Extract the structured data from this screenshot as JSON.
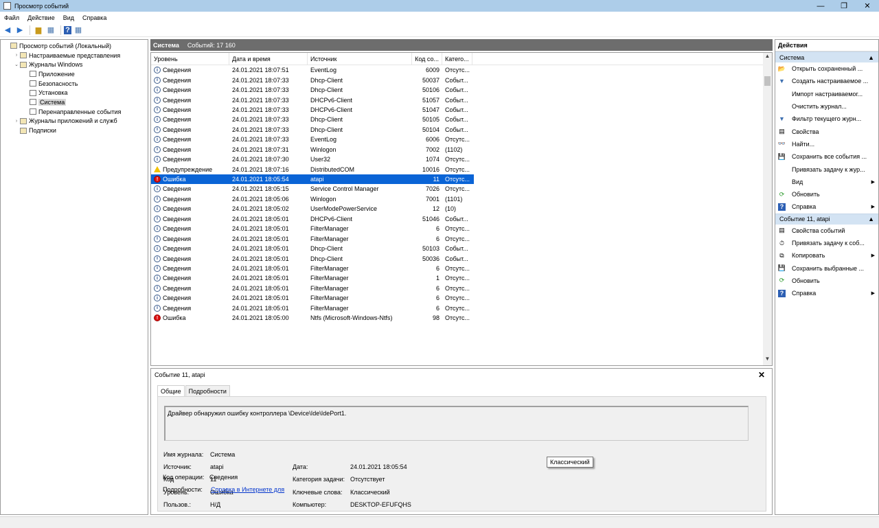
{
  "window": {
    "title": "Просмотр событий",
    "min": "—",
    "max": "❐",
    "close": "✕"
  },
  "menu": [
    "Файл",
    "Действие",
    "Вид",
    "Справка"
  ],
  "tree": [
    {
      "label": "Просмотр событий (Локальный)",
      "level": 0,
      "arrow": ""
    },
    {
      "label": "Настраиваемые представления",
      "level": 1,
      "arrow": "›"
    },
    {
      "label": "Журналы Windows",
      "level": 1,
      "arrow": "⌄"
    },
    {
      "label": "Приложение",
      "level": 2,
      "arrow": ""
    },
    {
      "label": "Безопасность",
      "level": 2,
      "arrow": ""
    },
    {
      "label": "Установка",
      "level": 2,
      "arrow": ""
    },
    {
      "label": "Система",
      "level": 2,
      "arrow": "",
      "selected": true
    },
    {
      "label": "Перенаправленные события",
      "level": 2,
      "arrow": ""
    },
    {
      "label": "Журналы приложений и служб",
      "level": 1,
      "arrow": "›"
    },
    {
      "label": "Подписки",
      "level": 1,
      "arrow": ""
    }
  ],
  "list": {
    "title": "Система",
    "count": "Событий: 17 160",
    "columns": [
      "Уровень",
      "Дата и время",
      "Источник",
      "Код со...",
      "Катего..."
    ],
    "rows": [
      {
        "level": "Сведения",
        "type": "info",
        "date": "24.01.2021 18:07:51",
        "source": "EventLog",
        "code": "6009",
        "cat": "Отсутс..."
      },
      {
        "level": "Сведения",
        "type": "info",
        "date": "24.01.2021 18:07:33",
        "source": "Dhcp-Client",
        "code": "50037",
        "cat": "Событ..."
      },
      {
        "level": "Сведения",
        "type": "info",
        "date": "24.01.2021 18:07:33",
        "source": "Dhcp-Client",
        "code": "50106",
        "cat": "Событ..."
      },
      {
        "level": "Сведения",
        "type": "info",
        "date": "24.01.2021 18:07:33",
        "source": "DHCPv6-Client",
        "code": "51057",
        "cat": "Событ..."
      },
      {
        "level": "Сведения",
        "type": "info",
        "date": "24.01.2021 18:07:33",
        "source": "DHCPv6-Client",
        "code": "51047",
        "cat": "Событ..."
      },
      {
        "level": "Сведения",
        "type": "info",
        "date": "24.01.2021 18:07:33",
        "source": "Dhcp-Client",
        "code": "50105",
        "cat": "Событ..."
      },
      {
        "level": "Сведения",
        "type": "info",
        "date": "24.01.2021 18:07:33",
        "source": "Dhcp-Client",
        "code": "50104",
        "cat": "Событ..."
      },
      {
        "level": "Сведения",
        "type": "info",
        "date": "24.01.2021 18:07:33",
        "source": "EventLog",
        "code": "6006",
        "cat": "Отсутс..."
      },
      {
        "level": "Сведения",
        "type": "info",
        "date": "24.01.2021 18:07:31",
        "source": "Winlogon",
        "code": "7002",
        "cat": "(1102)"
      },
      {
        "level": "Сведения",
        "type": "info",
        "date": "24.01.2021 18:07:30",
        "source": "User32",
        "code": "1074",
        "cat": "Отсутс..."
      },
      {
        "level": "Предупреждение",
        "type": "warn",
        "date": "24.01.2021 18:07:16",
        "source": "DistributedCOM",
        "code": "10016",
        "cat": "Отсутс..."
      },
      {
        "level": "Ошибка",
        "type": "err",
        "date": "24.01.2021 18:05:54",
        "source": "atapi",
        "code": "11",
        "cat": "Отсутс...",
        "selected": true
      },
      {
        "level": "Сведения",
        "type": "info",
        "date": "24.01.2021 18:05:15",
        "source": "Service Control Manager",
        "code": "7026",
        "cat": "Отсутс..."
      },
      {
        "level": "Сведения",
        "type": "info",
        "date": "24.01.2021 18:05:06",
        "source": "Winlogon",
        "code": "7001",
        "cat": "(1101)"
      },
      {
        "level": "Сведения",
        "type": "info",
        "date": "24.01.2021 18:05:02",
        "source": "UserModePowerService",
        "code": "12",
        "cat": "(10)"
      },
      {
        "level": "Сведения",
        "type": "info",
        "date": "24.01.2021 18:05:01",
        "source": "DHCPv6-Client",
        "code": "51046",
        "cat": "Событ..."
      },
      {
        "level": "Сведения",
        "type": "info",
        "date": "24.01.2021 18:05:01",
        "source": "FilterManager",
        "code": "6",
        "cat": "Отсутс..."
      },
      {
        "level": "Сведения",
        "type": "info",
        "date": "24.01.2021 18:05:01",
        "source": "FilterManager",
        "code": "6",
        "cat": "Отсутс..."
      },
      {
        "level": "Сведения",
        "type": "info",
        "date": "24.01.2021 18:05:01",
        "source": "Dhcp-Client",
        "code": "50103",
        "cat": "Событ..."
      },
      {
        "level": "Сведения",
        "type": "info",
        "date": "24.01.2021 18:05:01",
        "source": "Dhcp-Client",
        "code": "50036",
        "cat": "Событ..."
      },
      {
        "level": "Сведения",
        "type": "info",
        "date": "24.01.2021 18:05:01",
        "source": "FilterManager",
        "code": "6",
        "cat": "Отсутс..."
      },
      {
        "level": "Сведения",
        "type": "info",
        "date": "24.01.2021 18:05:01",
        "source": "FilterManager",
        "code": "1",
        "cat": "Отсутс..."
      },
      {
        "level": "Сведения",
        "type": "info",
        "date": "24.01.2021 18:05:01",
        "source": "FilterManager",
        "code": "6",
        "cat": "Отсутс..."
      },
      {
        "level": "Сведения",
        "type": "info",
        "date": "24.01.2021 18:05:01",
        "source": "FilterManager",
        "code": "6",
        "cat": "Отсутс..."
      },
      {
        "level": "Сведения",
        "type": "info",
        "date": "24.01.2021 18:05:01",
        "source": "FilterManager",
        "code": "6",
        "cat": "Отсутс..."
      },
      {
        "level": "Ошибка",
        "type": "err",
        "date": "24.01.2021 18:05:00",
        "source": "Ntfs (Microsoft-Windows-Ntfs)",
        "code": "98",
        "cat": "Отсутс..."
      }
    ]
  },
  "detail": {
    "title": "Событие 11, atapi",
    "close": "✕",
    "tabs": [
      "Общие",
      "Подробности"
    ],
    "message": "Драйвер обнаружил ошибку контроллера \\Device\\Ide\\IdePort1.",
    "log_name_label": "Имя журнала:",
    "log_name": "Система",
    "source_label": "Источник:",
    "source": "atapi",
    "date_label": "Дата:",
    "date": "24.01.2021 18:05:54",
    "code_label": "Код",
    "code": "11",
    "task_label": "Категория задачи:",
    "task": "Отсутствует",
    "level_label": "Уровень:",
    "level": "Ошибка",
    "keywords_label": "Ключевые слова:",
    "keywords": "Классический",
    "user_label": "Пользов.:",
    "user": "Н/Д",
    "computer_label": "Компьютер:",
    "computer": "DESKTOP-EFUFQHS",
    "opcode_label": "Код операции:",
    "opcode": "Сведения",
    "more_label": "Подробности:",
    "more_link": "Справка в Интернете для",
    "tooltip": "Классический"
  },
  "actions": {
    "header": "Действия",
    "section1": "Система",
    "items1": [
      {
        "label": "Открыть сохраненный ...",
        "icon": "open-folder-icon",
        "glyph": "📂"
      },
      {
        "label": "Создать настраиваемое ...",
        "icon": "filter-create-icon",
        "glyph": "▼"
      },
      {
        "label": "Импорт настраиваемог...",
        "icon": "none",
        "glyph": ""
      },
      {
        "label": "Очистить журнал...",
        "icon": "none",
        "glyph": ""
      },
      {
        "label": "Фильтр текущего журн...",
        "icon": "filter-icon",
        "glyph": "▼"
      },
      {
        "label": "Свойства",
        "icon": "properties-icon",
        "glyph": "▤"
      },
      {
        "label": "Найти...",
        "icon": "find-icon",
        "glyph": "👓"
      },
      {
        "label": "Сохранить все события ...",
        "icon": "save-icon",
        "glyph": "💾"
      },
      {
        "label": "Привязать задачу к жур...",
        "icon": "none",
        "glyph": ""
      },
      {
        "label": "Вид",
        "icon": "none",
        "glyph": "",
        "sub": true
      },
      {
        "label": "Обновить",
        "icon": "refresh-icon",
        "glyph": "⟳"
      },
      {
        "label": "Справка",
        "icon": "help-icon",
        "glyph": "?",
        "sub": true
      }
    ],
    "section2": "Событие 11, atapi",
    "items2": [
      {
        "label": "Свойства событий",
        "icon": "event-properties-icon",
        "glyph": "▤"
      },
      {
        "label": "Привязать задачу к соб...",
        "icon": "task-icon",
        "glyph": "⏱"
      },
      {
        "label": "Копировать",
        "icon": "copy-icon",
        "glyph": "⧉",
        "sub": true
      },
      {
        "label": "Сохранить выбранные ...",
        "icon": "save-icon",
        "glyph": "💾"
      },
      {
        "label": "Обновить",
        "icon": "refresh-icon",
        "glyph": "⟳"
      },
      {
        "label": "Справка",
        "icon": "help-icon",
        "glyph": "?",
        "sub": true
      }
    ]
  }
}
